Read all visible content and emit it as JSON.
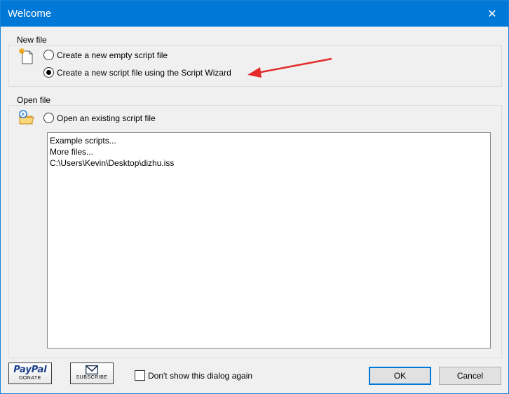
{
  "window": {
    "title": "Welcome",
    "close_glyph": "✕"
  },
  "new_file": {
    "group_label": "New file",
    "icon": "new-file-icon",
    "option_empty": "Create a new empty script file",
    "option_wizard": "Create a new script file using the Script Wizard",
    "selected": "wizard"
  },
  "open_file": {
    "group_label": "Open file",
    "icon": "open-folder-icon",
    "option_existing": "Open an existing script file",
    "items": [
      "Example scripts...",
      "More files...",
      "C:\\Users\\Kevin\\Desktop\\dizhu.iss"
    ]
  },
  "footer": {
    "paypal_brand": "PayPal",
    "paypal_caption": "DONATE",
    "subscribe_caption": "SUBSCRIBE",
    "dont_show_label": "Don't show this dialog again",
    "dont_show_checked": false,
    "ok_label": "OK",
    "cancel_label": "Cancel"
  },
  "colors": {
    "titlebar": "#0078d7",
    "annotation_arrow": "#e32b2b"
  }
}
